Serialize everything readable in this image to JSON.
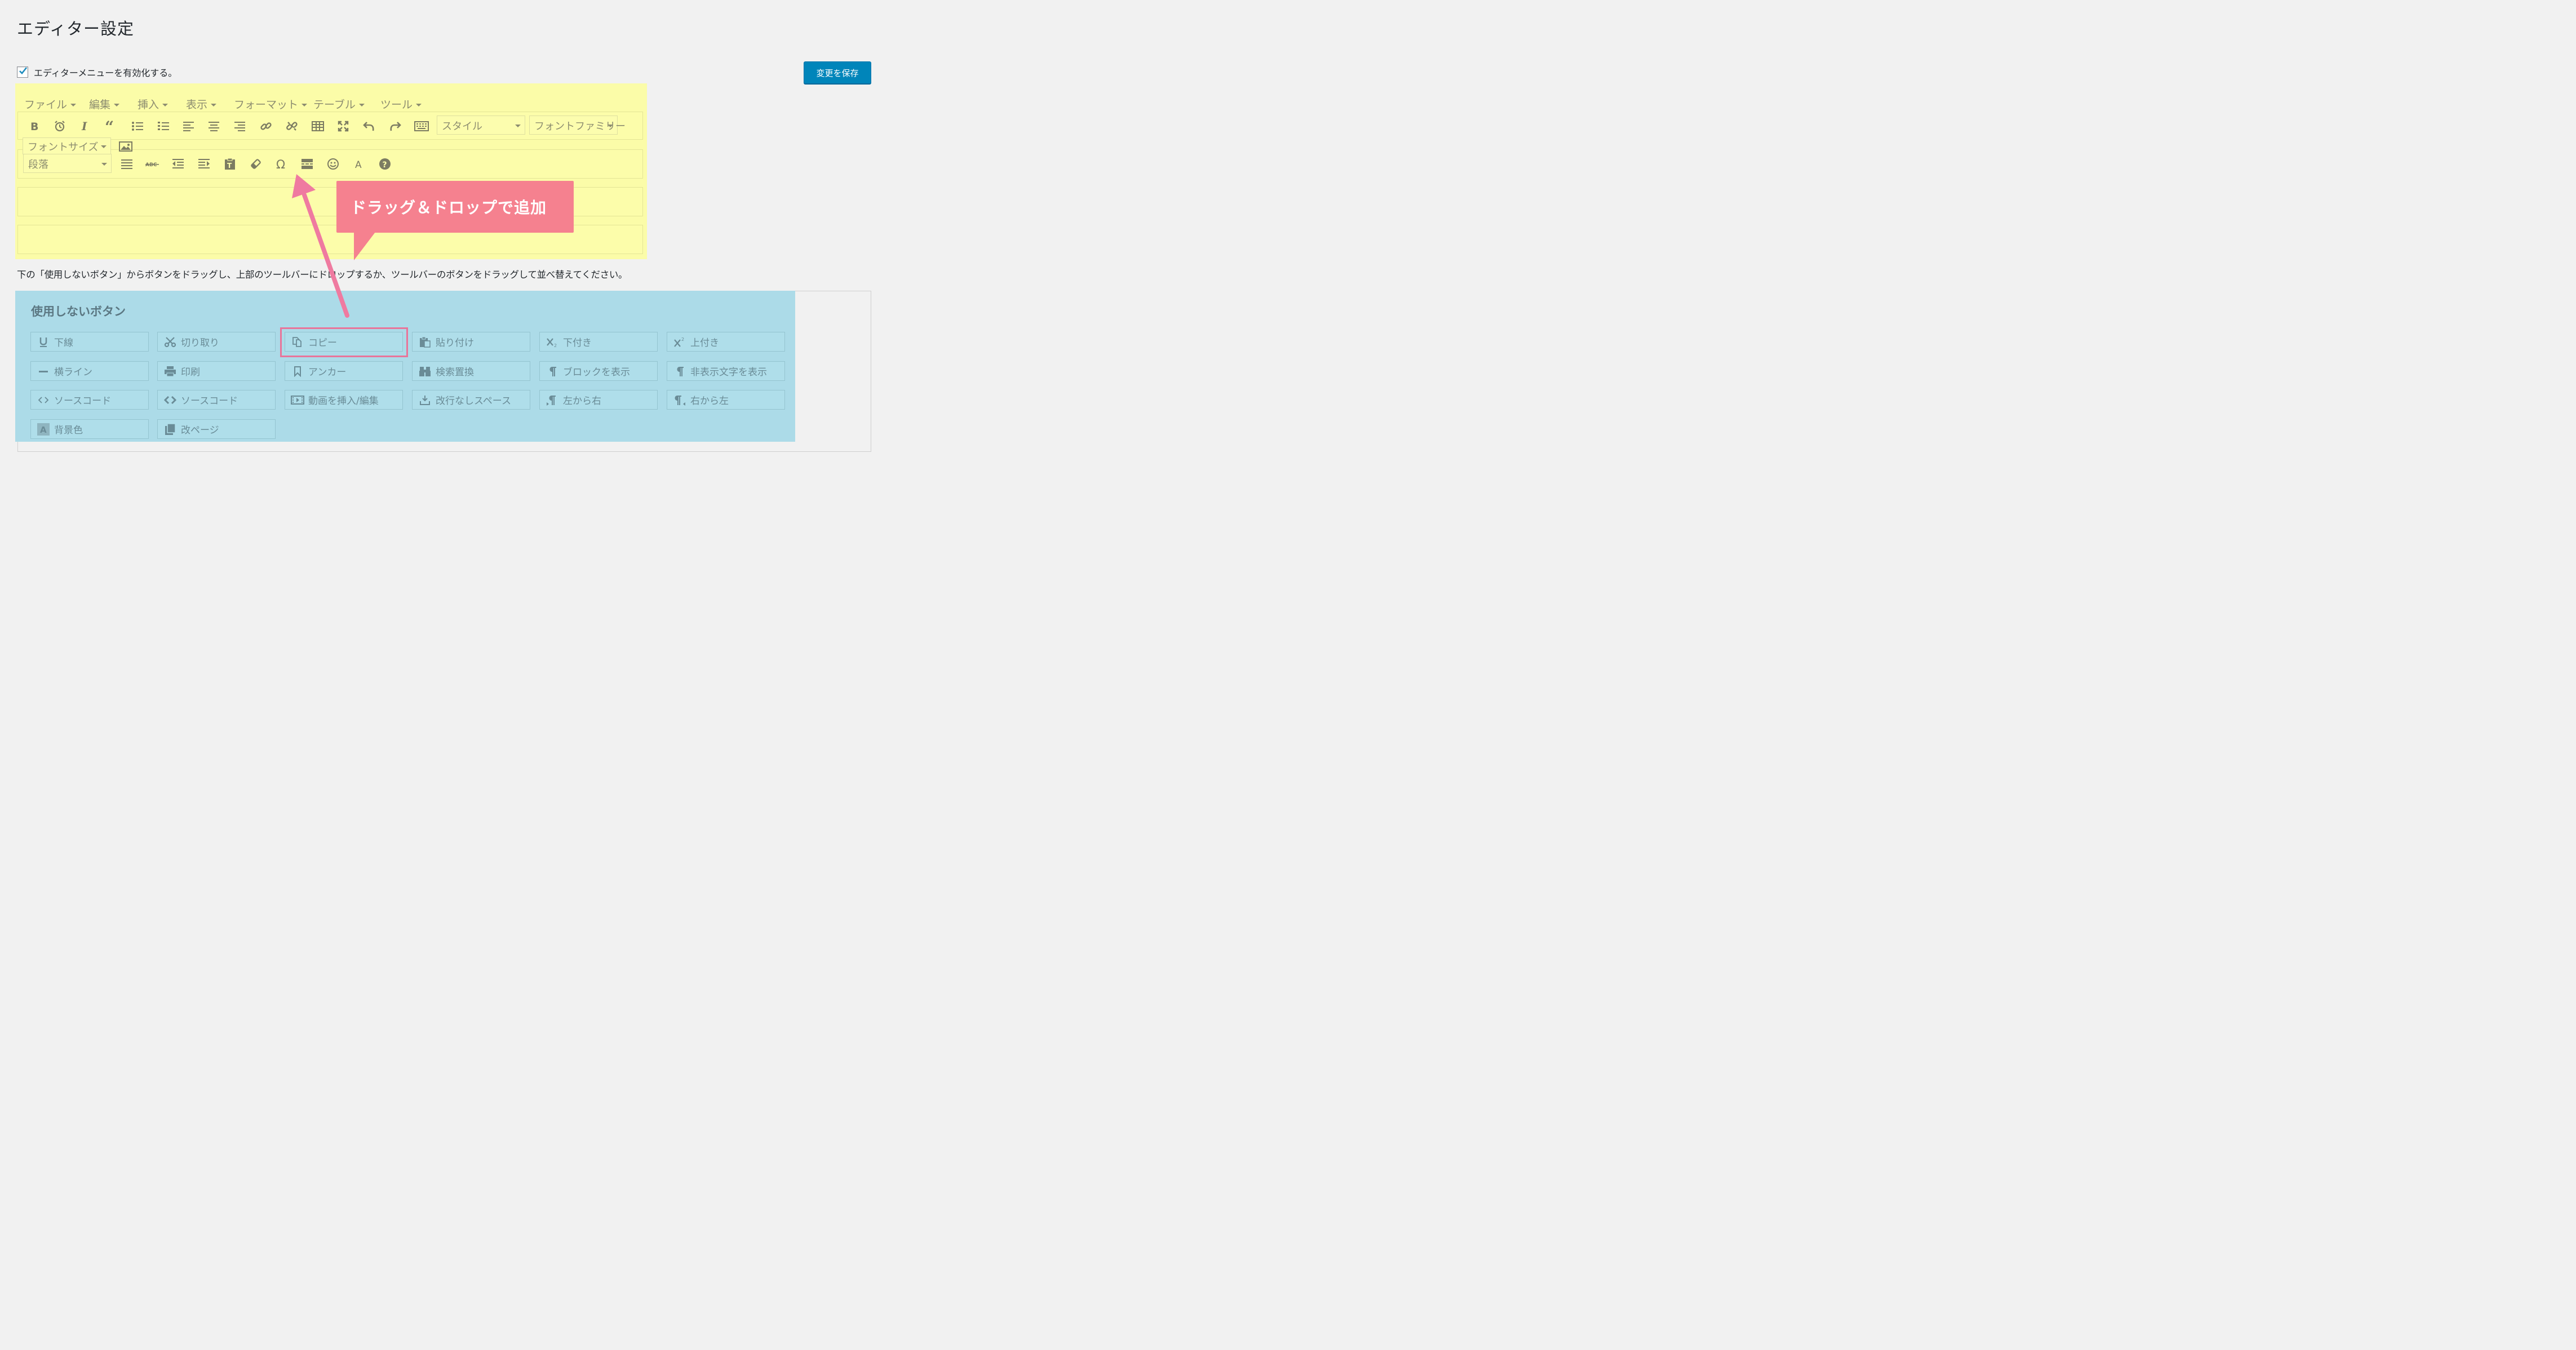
{
  "page": {
    "title": "エディター設定"
  },
  "enable_menu": {
    "checked": true,
    "label": "エディターメニューを有効化する。"
  },
  "save_button": {
    "label": "変更を保存"
  },
  "editor": {
    "menubar": [
      "ファイル",
      "編集",
      "挿入",
      "表示",
      "フォーマット",
      "テーブル",
      "ツール"
    ],
    "toolbar1_icons": [
      "bold-icon",
      "clock-icon",
      "italic-icon",
      "blockquote-icon",
      "bullet-list-icon",
      "numbered-list-icon",
      "align-left-icon",
      "align-center-icon",
      "align-right-icon",
      "link-icon",
      "unlink-icon",
      "table-icon",
      "fullscreen-icon",
      "undo-icon",
      "redo-icon",
      "keyboard-icon"
    ],
    "style_select": "スタイル",
    "font_family_select": "フォントファミリー",
    "font_size_select": "フォントサイズ",
    "paragraph_select": "段落",
    "toolbar2_icons": [
      "justify-icon",
      "strikethrough-icon",
      "outdent-icon",
      "indent-icon",
      "paste-text-icon",
      "eraser-icon",
      "omega-icon",
      "read-more-icon",
      "emoticon-icon",
      "text-color-icon",
      "help-icon"
    ],
    "image_icon": "image-icon"
  },
  "instruction": "下の「使用しないボタン」からボタンをドラッグし、上部のツールバーにドロップするか、ツールバーのボタンをドラッグして並べ替えてください。",
  "unused": {
    "heading": "使用しないボタン",
    "buttons": [
      {
        "label": "下線",
        "icon": "underline-icon"
      },
      {
        "label": "切り取り",
        "icon": "scissors-icon"
      },
      {
        "label": "コピー",
        "icon": "copy-icon"
      },
      {
        "label": "貼り付け",
        "icon": "paste-icon"
      },
      {
        "label": "下付き",
        "icon": "subscript-icon"
      },
      {
        "label": "上付き",
        "icon": "superscript-icon"
      },
      {
        "label": "横ライン",
        "icon": "horizontal-line-icon"
      },
      {
        "label": "印刷",
        "icon": "print-icon"
      },
      {
        "label": "アンカー",
        "icon": "anchor-bookmark-icon"
      },
      {
        "label": "検索置換",
        "icon": "binoculars-icon"
      },
      {
        "label": "ブロックを表示",
        "icon": "pilcrow-icon"
      },
      {
        "label": "非表示文字を表示",
        "icon": "pilcrow-icon"
      },
      {
        "label": "ソースコード",
        "icon": "code-icon"
      },
      {
        "label": "ソースコード",
        "icon": "code-bold-icon"
      },
      {
        "label": "動画を挿入/編集",
        "icon": "media-icon"
      },
      {
        "label": "改行なしスペース",
        "icon": "nonbreaking-icon"
      },
      {
        "label": "左から右",
        "icon": "ltr-icon"
      },
      {
        "label": "右から左",
        "icon": "rtl-icon"
      },
      {
        "label": "背景色",
        "icon": "background-color-icon"
      },
      {
        "label": "改ページ",
        "icon": "page-break-icon"
      }
    ]
  },
  "callout": {
    "text": "ドラッグ＆ドロップで追加"
  },
  "colors": {
    "editor_highlight": "#fbfca8",
    "unused_highlight": "#acdbe8",
    "callout": "#f5818f",
    "copy_outline": "#e8759a",
    "primary_button": "#0085ba"
  }
}
